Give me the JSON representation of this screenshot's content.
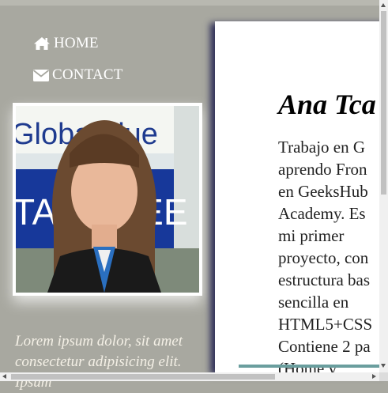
{
  "nav": {
    "items": [
      {
        "label": "HOME",
        "icon": "home-icon"
      },
      {
        "label": "CONTACT",
        "icon": "envelope-icon"
      }
    ]
  },
  "photo": {
    "backdrop_text": "GlobalBlue",
    "backdrop_text_2": "TAX FREE"
  },
  "quote": "Lorem ipsum dolor, sit amet consectetur adipisicing elit. Ipsum",
  "card": {
    "name": "Ana Tca",
    "bio_lines": [
      "Trabajo en G",
      "aprendo Fron",
      "en GeeksHub",
      "Academy. Es",
      "mi primer",
      "proyecto, con",
      "estructura bas",
      "sencilla en",
      "HTML5+CSS",
      "Contiene 2 pa",
      "(Home y"
    ]
  },
  "colors": {
    "background": "#a8a8a0",
    "card": "#ffffff",
    "card_shadow": "#303058",
    "quote_text": "#f4f0e6",
    "accent_line": "#6a9e9e"
  }
}
